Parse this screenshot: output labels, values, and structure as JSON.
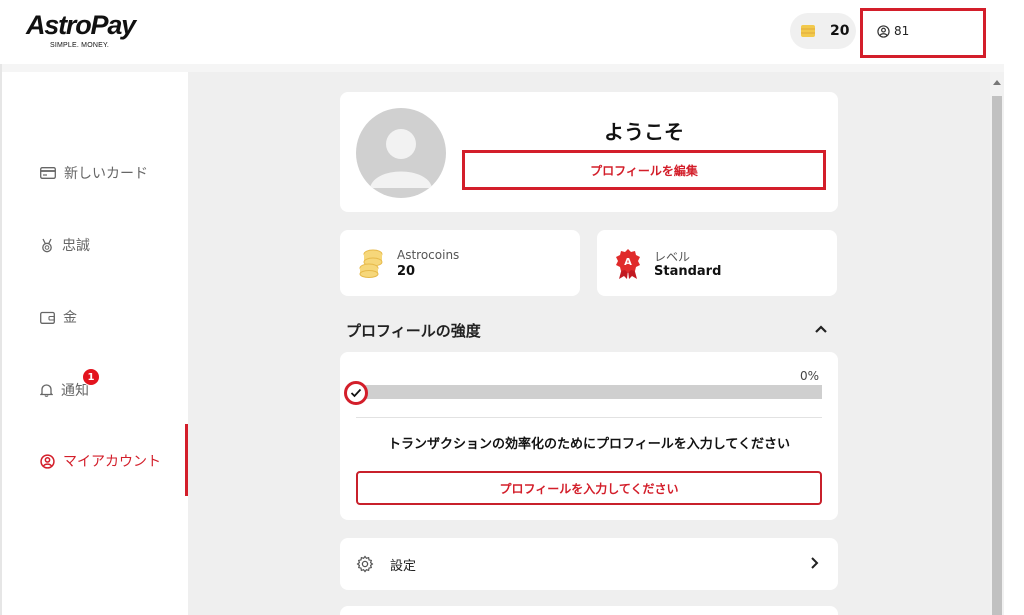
{
  "header": {
    "logo_text": "AstroPay",
    "logo_tagline": "SIMPLE. MONEY.",
    "coins_count": "20",
    "account_id": "81"
  },
  "sidebar": {
    "items": [
      {
        "label": "新しいカード",
        "icon": "card-icon"
      },
      {
        "label": "忠誠",
        "icon": "medal-icon"
      },
      {
        "label": "金",
        "icon": "wallet-icon"
      },
      {
        "label": "通知",
        "icon": "bell-icon",
        "badge": "1"
      },
      {
        "label": "マイアカウント",
        "icon": "user-circle-icon",
        "active": true
      }
    ]
  },
  "profile": {
    "welcome": "ようこそ",
    "edit_button": "プロフィールを編集"
  },
  "stats": {
    "astrocoins_label": "Astrocoins",
    "astrocoins_value": "20",
    "level_label": "レベル",
    "level_value": "Standard"
  },
  "strength": {
    "title": "プロフィールの強度",
    "percent_text": "0%",
    "progress": 0,
    "prompt": "トランザクションの効率化のためにプロフィールを入力してください",
    "button": "プロフィールを入力してください"
  },
  "menu": {
    "settings_label": "設定"
  },
  "colors": {
    "accent": "#d31e2a",
    "background": "#efefef",
    "coin": "#f2c94c"
  }
}
